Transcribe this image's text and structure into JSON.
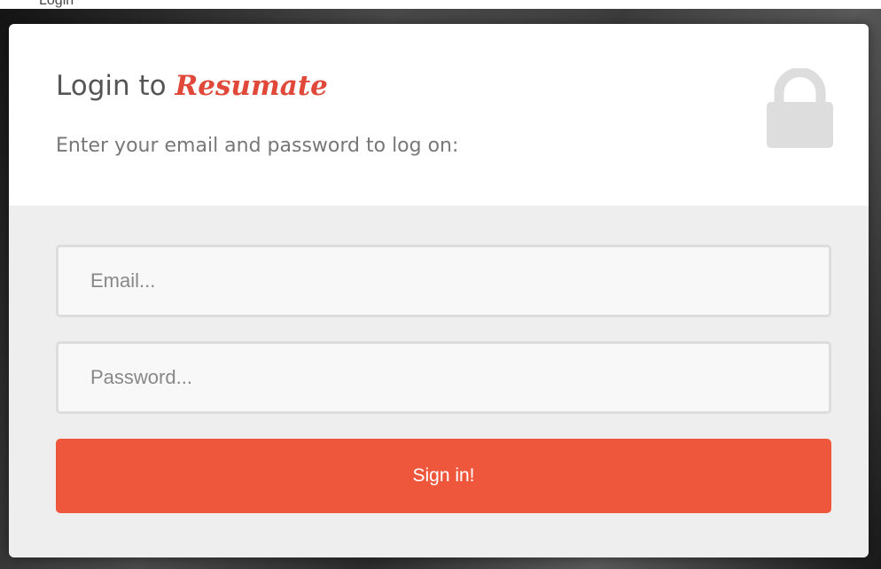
{
  "top_strip": {
    "text": "Login"
  },
  "login": {
    "title_prefix": "Login to",
    "brand": "Resumate",
    "subtitle": "Enter your email and password to log on:",
    "email_placeholder": "Email...",
    "password_placeholder": "Password...",
    "submit_label": "Sign in!"
  },
  "icons": {
    "header": "lock-icon"
  },
  "colors": {
    "accent": "#ef573c",
    "brand": "#e0493a",
    "lock": "#dddddd",
    "panel": "#eeeeee"
  }
}
